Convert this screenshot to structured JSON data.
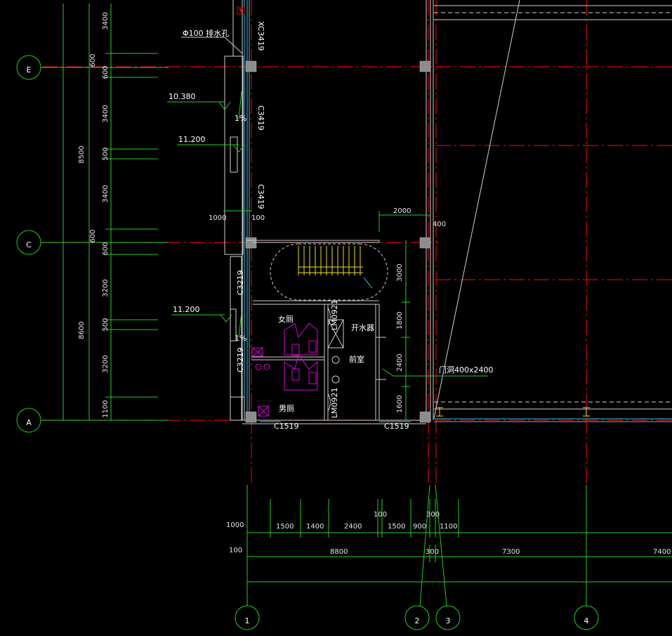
{
  "axis_bubbles": {
    "E": "E",
    "C": "C",
    "A": "A",
    "n1": "1",
    "n2": "2",
    "n3": "3",
    "n4": "4"
  },
  "left_dims": {
    "d3400a": "3400",
    "d600a": "600",
    "d600b": "600",
    "d3400b": "3400",
    "d500a": "500",
    "d3400c": "3400",
    "d600c": "600",
    "d600d": "600",
    "d3200a": "3200",
    "d500b": "500",
    "d3200b": "3200",
    "d1100": "1100",
    "total_upper": "8500",
    "total_lower": "8600"
  },
  "annotations": {
    "drain": "Φ100 排水孔",
    "elev1": "10.380",
    "elev2": "11.200",
    "elev3": "11.200",
    "slope1": "1%",
    "slope2": "1%",
    "d1000": "1000",
    "d100": "100",
    "d2000": "2000",
    "d400": "400",
    "win_xc": "XC3419",
    "win_c3419a": "C3419",
    "win_c3419b": "C3419",
    "win_c3219a": "C3219",
    "win_c3219b": "C3219",
    "win_c1519a": "C1519",
    "win_c1519b": "C1519",
    "door_lm1": "LM0921",
    "door_lm2": "LM0921",
    "room_women": "女厕",
    "room_men": "男厕",
    "room_front": "前室",
    "water_heater": "开水器",
    "door_note": "门洞400x2400",
    "rd3000": "3000",
    "rd1800": "1800",
    "rd2400": "2400",
    "rd1600": "1600"
  },
  "bottom_dims": {
    "b1000": "1000",
    "b1500a": "1500",
    "b1400": "1400",
    "b2400": "2400",
    "b100a": "100",
    "b1500b": "1500",
    "b900": "900",
    "b300a": "300",
    "b1100": "1100",
    "b100b": "100",
    "b8800": "8800",
    "b300b": "300",
    "b7300": "7300",
    "b7400": "7400"
  }
}
